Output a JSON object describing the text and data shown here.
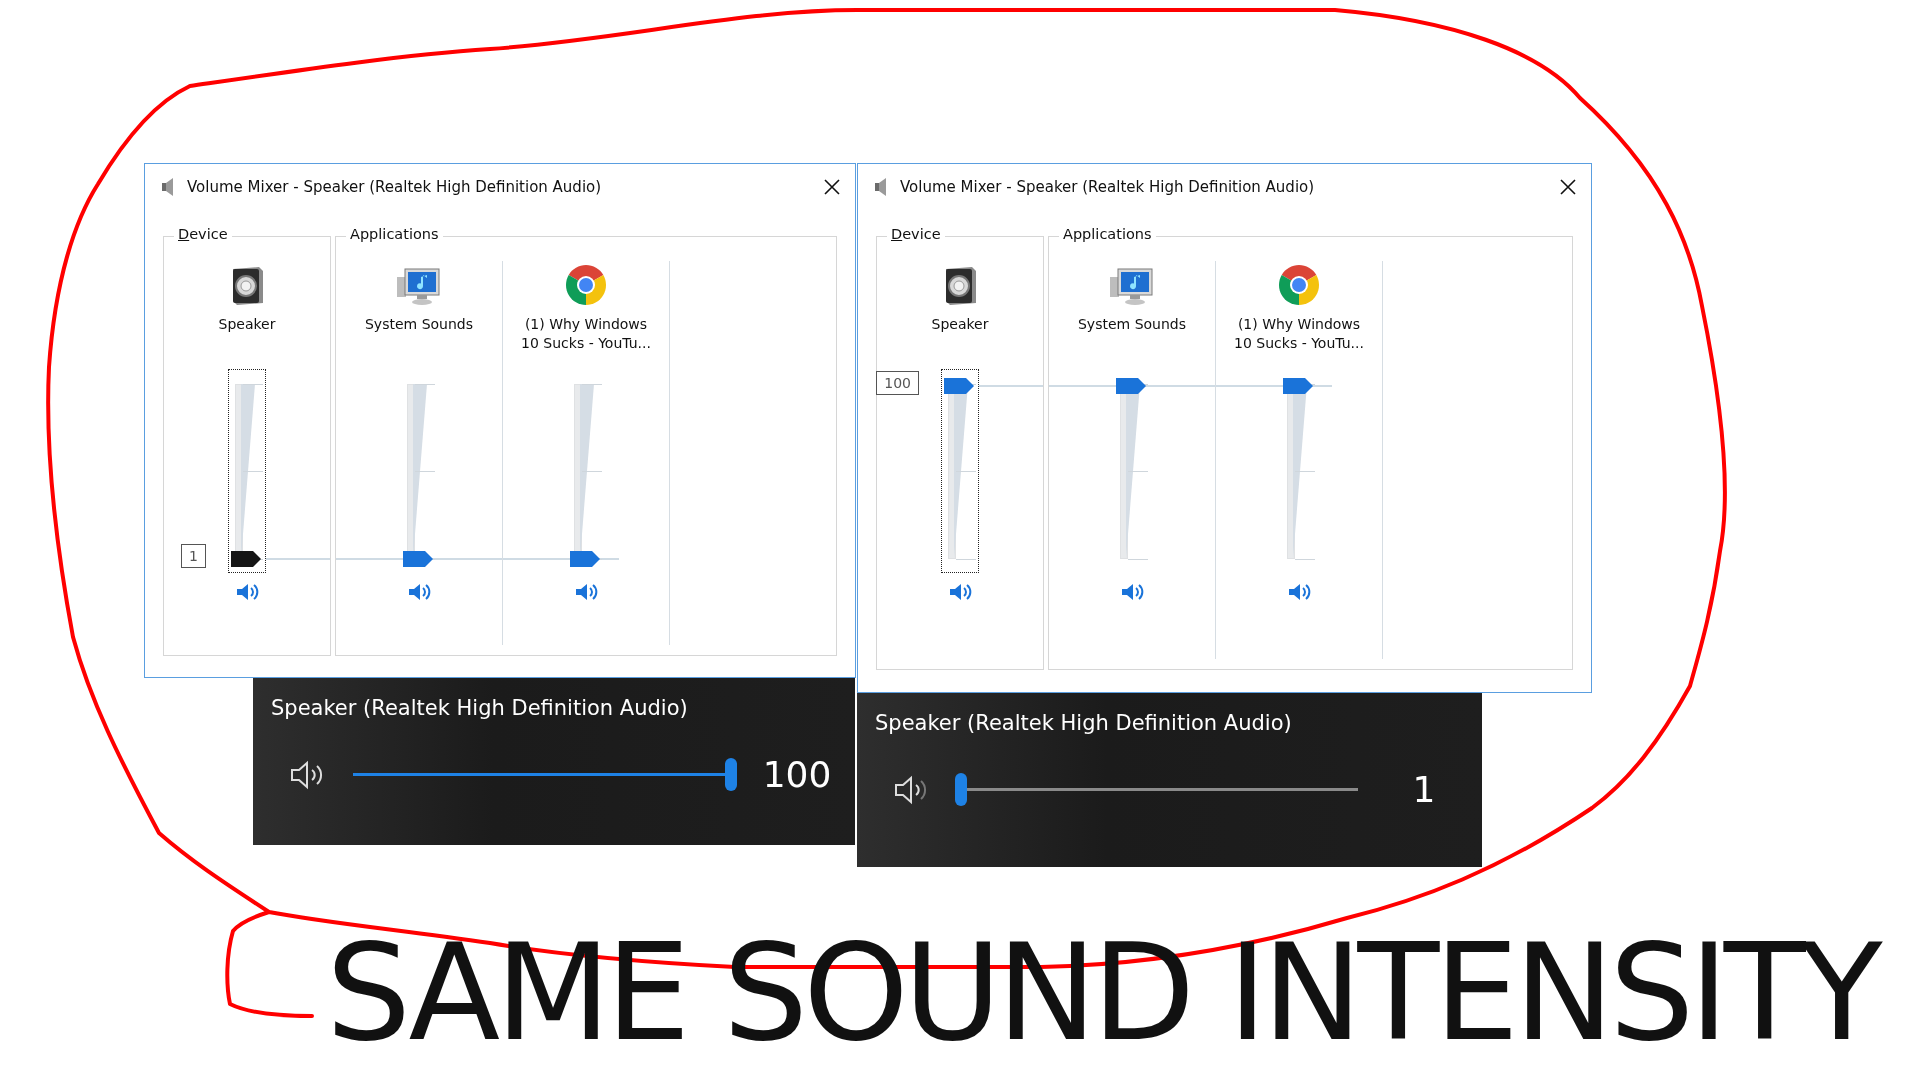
{
  "panels": [
    {
      "window": {
        "title": "Volume Mixer - Speaker (Realtek High Definition Audio)",
        "device_label": "Device",
        "applications_label": "Applications",
        "channels": [
          {
            "kind": "device",
            "name": "Speaker",
            "level": 0.01,
            "reading": "1",
            "focused": true,
            "pressed": true
          },
          {
            "kind": "system_sounds",
            "name": "System Sounds",
            "level": 0.01,
            "focused": false,
            "pressed": false
          },
          {
            "kind": "browser",
            "name": "(1) Why Windows 10 Sucks - YouTu...",
            "level": 0.01,
            "focused": false,
            "pressed": false
          }
        ]
      },
      "flyout": {
        "device": "Speaker (Realtek High Definition Audio)",
        "level": 1,
        "reading": "100"
      }
    },
    {
      "window": {
        "title": "Volume Mixer - Speaker (Realtek High Definition Audio)",
        "device_label": "Device",
        "applications_label": "Applications",
        "channels": [
          {
            "kind": "device",
            "name": "Speaker",
            "level": 1,
            "reading": "100",
            "focused": true,
            "pressed": false
          },
          {
            "kind": "system_sounds",
            "name": "System Sounds",
            "level": 1,
            "focused": false,
            "pressed": false
          },
          {
            "kind": "browser",
            "name": "(1) Why Windows 10 Sucks - YouTu...",
            "level": 1,
            "focused": false,
            "pressed": false
          }
        ]
      },
      "flyout": {
        "device": "Speaker (Realtek High Definition Audio)",
        "level": 0.01,
        "reading": "1"
      }
    }
  ],
  "caption": "SAME SOUND INTENSITY"
}
